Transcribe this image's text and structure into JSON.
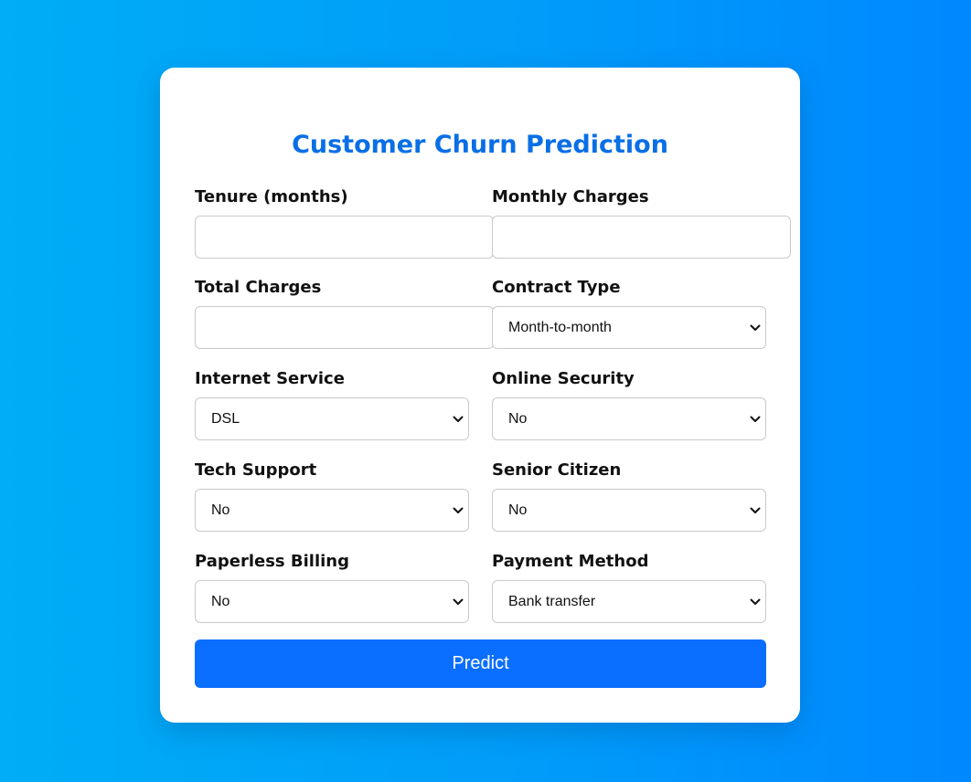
{
  "page": {
    "title": "Customer Churn Prediction"
  },
  "form": {
    "tenure": {
      "label": "Tenure (months)",
      "value": "",
      "placeholder": ""
    },
    "monthly_charges": {
      "label": "Monthly Charges",
      "value": "",
      "placeholder": ""
    },
    "total_charges": {
      "label": "Total Charges",
      "value": "",
      "placeholder": ""
    },
    "contract_type": {
      "label": "Contract Type",
      "selected": "Month-to-month"
    },
    "internet_service": {
      "label": "Internet Service",
      "selected": "DSL"
    },
    "online_security": {
      "label": "Online Security",
      "selected": "No"
    },
    "tech_support": {
      "label": "Tech Support",
      "selected": "No"
    },
    "senior_citizen": {
      "label": "Senior Citizen",
      "selected": "No"
    },
    "paperless_billing": {
      "label": "Paperless Billing",
      "selected": "No"
    },
    "payment_method": {
      "label": "Payment Method",
      "selected": "Bank transfer"
    },
    "submit_label": "Predict"
  },
  "icons": {
    "dropdown": "chevron-down-icon"
  },
  "colors": {
    "accent": "#0a6fe6",
    "button": "#0a6eff",
    "background_start": "#00adf6",
    "background_end": "#0088ff"
  }
}
